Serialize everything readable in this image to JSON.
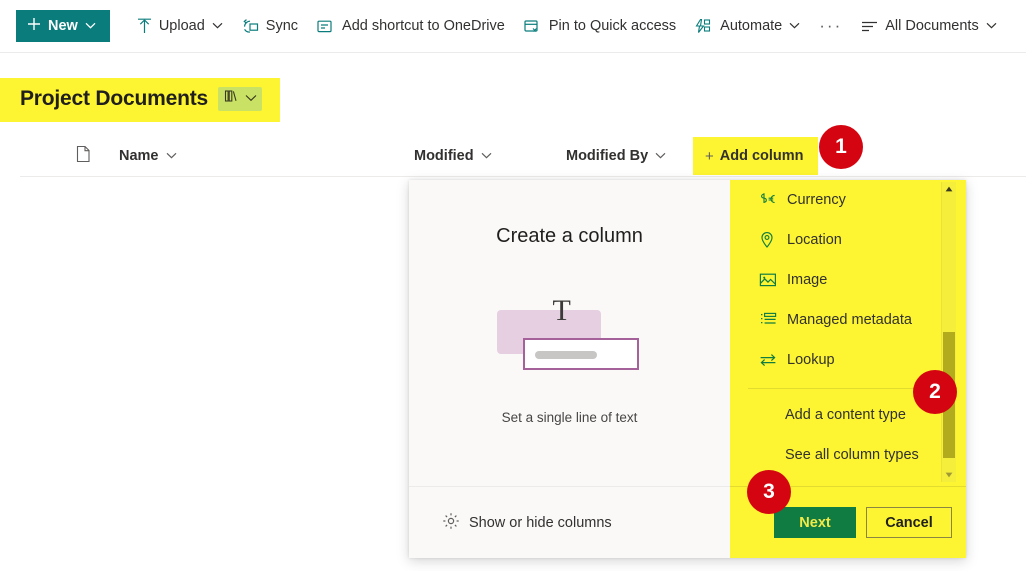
{
  "commandbar": {
    "new_label": "New",
    "items": [
      {
        "label": "Upload",
        "icon": "upload-icon",
        "has_chevron": true
      },
      {
        "label": "Sync",
        "icon": "sync-icon",
        "has_chevron": false
      },
      {
        "label": "Add shortcut to OneDrive",
        "icon": "onedrive-shortcut-icon",
        "has_chevron": false
      },
      {
        "label": "Pin to Quick access",
        "icon": "pin-icon",
        "has_chevron": false
      },
      {
        "label": "Automate",
        "icon": "automate-icon",
        "has_chevron": true
      }
    ],
    "overflow_label": "···",
    "view_label": "All Documents"
  },
  "page": {
    "title": "Project Documents"
  },
  "columns": {
    "name": "Name",
    "modified": "Modified",
    "modified_by": "Modified By",
    "add_column": "Add column",
    "add_column_plus": "+"
  },
  "dialog": {
    "title": "Create a column",
    "illustration_caption": "Set a single line of text",
    "illustration_letter": "T",
    "show_hide_columns": "Show or hide columns",
    "column_types": [
      {
        "label": "Currency",
        "icon": "currency-icon"
      },
      {
        "label": "Location",
        "icon": "location-pin-icon"
      },
      {
        "label": "Image",
        "icon": "image-icon"
      },
      {
        "label": "Managed metadata",
        "icon": "managed-metadata-icon"
      },
      {
        "label": "Lookup",
        "icon": "lookup-icon"
      }
    ],
    "extra_links": [
      {
        "label": "Add a content type"
      },
      {
        "label": "See all column types"
      }
    ],
    "next_label": "Next",
    "cancel_label": "Cancel"
  },
  "badges": {
    "one": "1",
    "two": "2",
    "three": "3"
  },
  "colors": {
    "highlight": "#fdf531",
    "teal": "#0b7c7c",
    "green": "#107c41",
    "badge_red": "#d40511"
  }
}
